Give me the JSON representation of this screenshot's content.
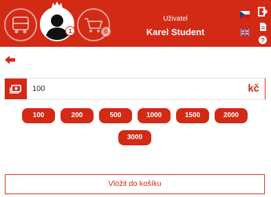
{
  "header": {
    "user_role": "Uživatel",
    "user_name": "Karel Student",
    "user_badge": "1",
    "cart_badge": "0",
    "icons": [
      "bus-icon",
      "user-avatar-icon",
      "cart-icon",
      "crown-icon",
      "flag-cz-icon",
      "flag-uk-icon",
      "logout-icon",
      "document-icon",
      "help-icon"
    ]
  },
  "amount": {
    "value": "100",
    "currency": "kč",
    "icon": "money-icon"
  },
  "presets": [
    "100",
    "200",
    "500",
    "1000",
    "1500",
    "2000",
    "3000"
  ],
  "actions": {
    "add_to_cart": "Vložit do košíku"
  },
  "colors": {
    "accent": "#d32a16",
    "background": "#ffffff"
  }
}
